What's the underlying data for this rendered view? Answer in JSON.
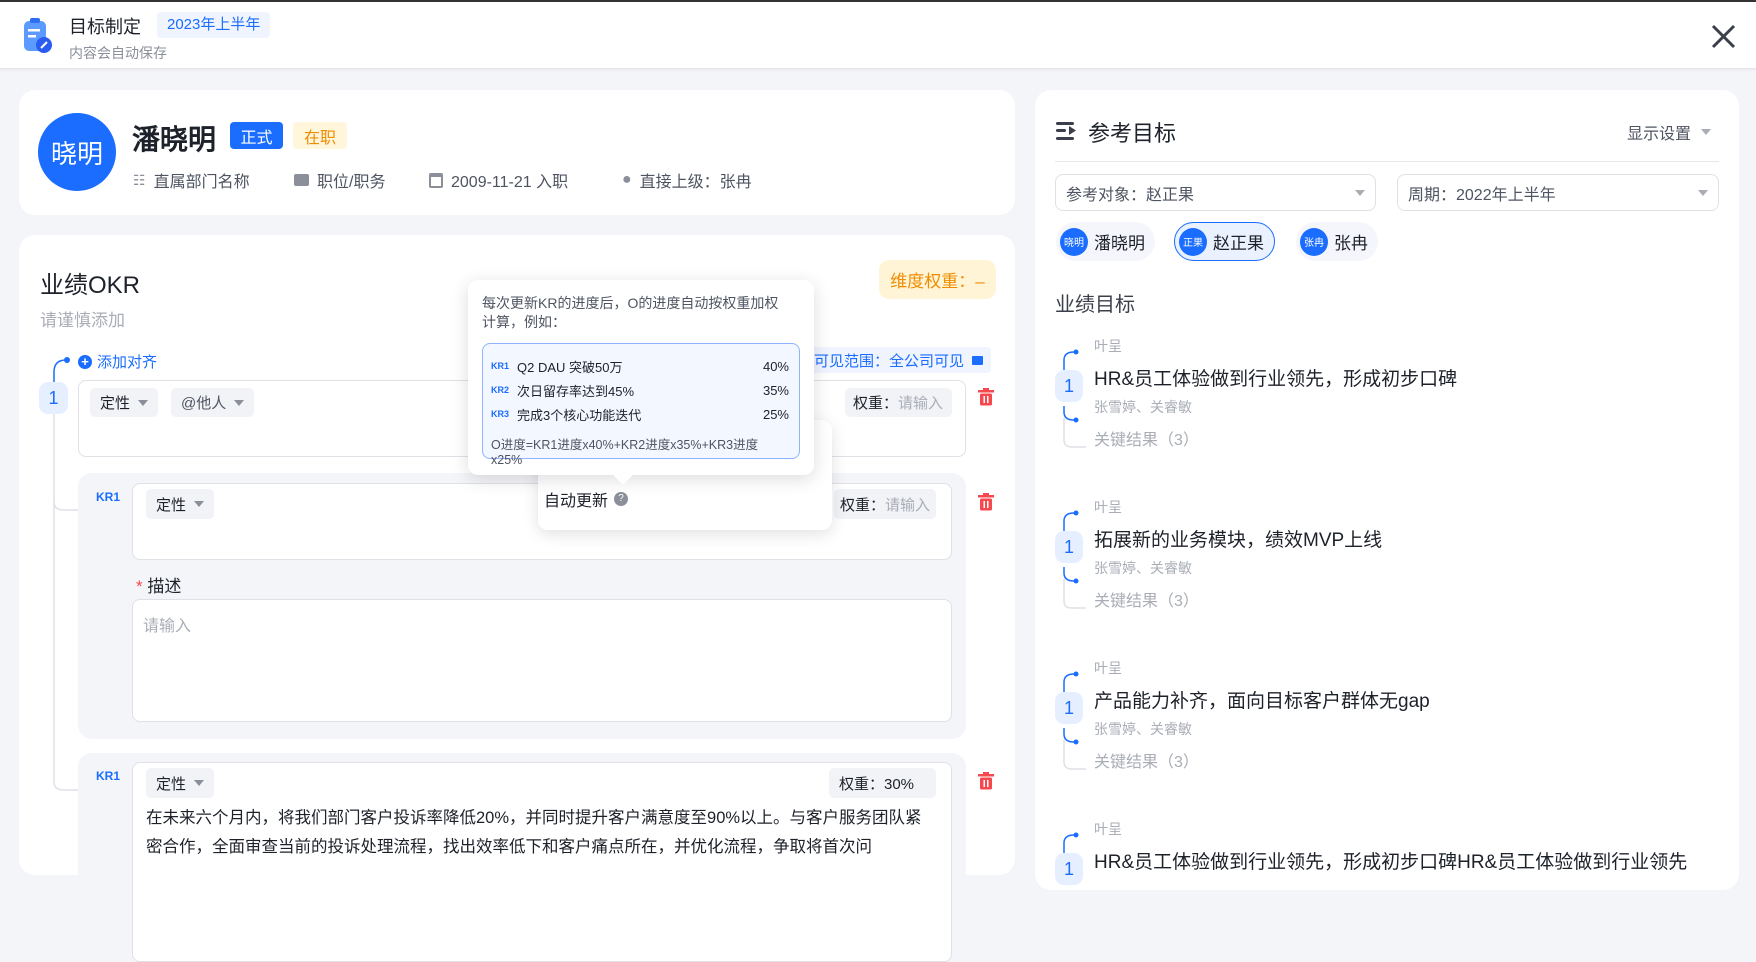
{
  "header": {
    "title": "目标制定",
    "period_badge": "2023年上半年",
    "subtitle": "内容会自动保存"
  },
  "profile": {
    "avatar_text": "晓明",
    "name": "潘晓明",
    "tag_formal": "正式",
    "tag_status": "在职",
    "department": "直属部门名称",
    "position": "职位/职务",
    "join_date": "2009-11-21 入职",
    "manager": "直接上级：张冉"
  },
  "okr": {
    "title": "业绩OKR",
    "subtitle": "请谨慎添加",
    "dimension_weight": "维度权重：–",
    "add_align": "添加对齐",
    "visibility": "可见范围：全公司可见",
    "objective_number": "1",
    "objective": {
      "type": "定性",
      "mention": "@他人",
      "weight_label": "权重：",
      "weight_placeholder": "请输入"
    },
    "kr1": {
      "label": "KR1",
      "type": "定性",
      "weight_label": "权重：",
      "weight_placeholder": "请输入",
      "desc_label": "描述",
      "desc_required": "*",
      "desc_placeholder": "请输入"
    },
    "kr2": {
      "label": "KR1",
      "type": "定性",
      "weight": "权重：30%",
      "text": "在未来六个月内，将我们部门客户投诉率降低20%，并同时提升客户满意度至90%以上。与客户服务团队紧密合作，全面审查当前的投诉处理流程，找出效率低下和客户痛点所在，并优化流程，争取将首次问"
    }
  },
  "popover": {
    "auto_update": "自动更新"
  },
  "tooltip": {
    "text": "每次更新KR的进度后，O的进度自动按权重加权计算，例如：",
    "rows": [
      {
        "kr": "KR1",
        "name": "Q2 DAU 突破50万",
        "weight": "40%"
      },
      {
        "kr": "KR2",
        "name": "次日留存率达到45%",
        "weight": "35%"
      },
      {
        "kr": "KR3",
        "name": "完成3个核心功能迭代",
        "weight": "25%"
      }
    ],
    "formula": "O进度=KR1进度x40%+KR2进度x35%+KR3进度x25%"
  },
  "reference": {
    "title": "参考目标",
    "display_settings": "显示设置",
    "target_select": "参考对象：赵正果",
    "period_select": "周期：2022年上半年",
    "people": [
      {
        "avatar": "晓明",
        "name": "潘晓明"
      },
      {
        "avatar": "正果",
        "name": "赵正果"
      },
      {
        "avatar": "张冉",
        "name": "张冉"
      }
    ],
    "section": "业绩目标",
    "goals": [
      {
        "owner": "叶呈",
        "number": "1",
        "title": "HR&员工体验做到行业领先，形成初步口碑",
        "aligned": "张雪婷、关睿敏",
        "kr": "关键结果（3）"
      },
      {
        "owner": "叶呈",
        "number": "1",
        "title": "拓展新的业务模块，绩效MVP上线",
        "aligned": "张雪婷、关睿敏",
        "kr": "关键结果（3）"
      },
      {
        "owner": "叶呈",
        "number": "1",
        "title": "产品能力补齐，面向目标客户群体无gap",
        "aligned": "张雪婷、关睿敏",
        "kr": "关键结果（3）"
      },
      {
        "owner": "叶呈",
        "number": "1",
        "title": "HR&员工体验做到行业领先，形成初步口碑HR&员工体验做到行业领先"
      }
    ]
  },
  "colors": {
    "primary": "#1a6dff",
    "danger": "#f5484f",
    "warning": "#f08c00"
  }
}
